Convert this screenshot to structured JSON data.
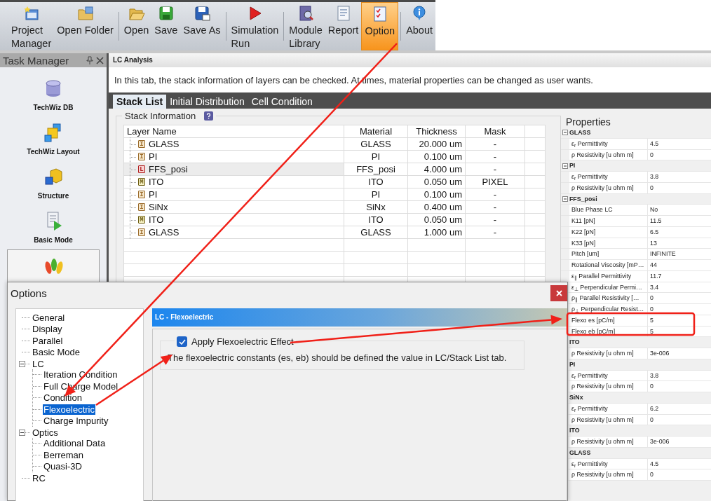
{
  "toolbar": {
    "groups": [
      [
        {
          "kind": "project",
          "lines": [
            "Project",
            "Manager"
          ],
          "selected": false
        },
        {
          "kind": "folder",
          "lines": [
            "Open Folder"
          ],
          "selected": false
        }
      ],
      [
        {
          "kind": "open",
          "lines": [
            "Open"
          ],
          "selected": false
        },
        {
          "kind": "save",
          "lines": [
            "Save"
          ],
          "selected": false
        },
        {
          "kind": "save-as",
          "lines": [
            "Save As"
          ],
          "selected": false
        }
      ],
      [
        {
          "kind": "run",
          "lines": [
            "Simulation",
            "Run"
          ],
          "selected": false
        }
      ],
      [
        {
          "kind": "library",
          "lines": [
            "Module",
            "Library"
          ],
          "selected": false
        },
        {
          "kind": "report",
          "lines": [
            "Report"
          ],
          "selected": false
        },
        {
          "kind": "option",
          "lines": [
            "Option"
          ],
          "selected": true
        }
      ],
      [
        {
          "kind": "about",
          "lines": [
            "About"
          ],
          "selected": false
        }
      ]
    ]
  },
  "task_manager": {
    "title": "Task Manager",
    "items": [
      {
        "kind": "db",
        "label": "TechWiz DB",
        "selected": false
      },
      {
        "kind": "layout",
        "label": "TechWiz Layout",
        "selected": false
      },
      {
        "kind": "structure",
        "label": "Structure",
        "selected": false
      },
      {
        "kind": "basic",
        "label": "Basic Mode",
        "selected": false
      },
      {
        "kind": "lc",
        "selected": true
      }
    ]
  },
  "analysis": {
    "title": "LC Analysis",
    "description": "In this tab, the stack information of layers can be checked. At times, material properties can be changed as user wants.",
    "tabs": [
      {
        "label": "Stack List",
        "selected": true
      },
      {
        "label": "Initial Distribution",
        "selected": false
      },
      {
        "label": "Cell Condition",
        "selected": false
      }
    ],
    "stack": {
      "title": "Stack Information",
      "columns": [
        "Layer Name",
        "Material",
        "Thickness",
        "Mask"
      ],
      "rows": [
        {
          "type": "I",
          "name": "GLASS",
          "material": "GLASS",
          "thickness": "20.000 um",
          "mask": "-",
          "selected": false
        },
        {
          "type": "I",
          "name": "PI",
          "material": "PI",
          "thickness": "0.100 um",
          "mask": "-",
          "selected": false
        },
        {
          "type": "L",
          "name": "FFS_posi",
          "material": "FFS_posi",
          "thickness": "4.000 um",
          "mask": "-",
          "selected": true
        },
        {
          "type": "M",
          "name": "ITO",
          "material": "ITO",
          "thickness": "0.050 um",
          "mask": "PIXEL",
          "selected": false
        },
        {
          "type": "I",
          "name": "PI",
          "material": "PI",
          "thickness": "0.100 um",
          "mask": "-",
          "selected": false
        },
        {
          "type": "I",
          "name": "SiNx",
          "material": "SiNx",
          "thickness": "0.400 um",
          "mask": "-",
          "selected": false
        },
        {
          "type": "M",
          "name": "ITO",
          "material": "ITO",
          "thickness": "0.050 um",
          "mask": "-",
          "selected": false
        },
        {
          "type": "I",
          "name": "GLASS",
          "material": "GLASS",
          "thickness": "1.000 um",
          "mask": "-",
          "selected": false
        }
      ]
    },
    "properties": {
      "title": "Properties",
      "groups": [
        {
          "name": "GLASS",
          "expanded": true,
          "rows": [
            {
              "label": "ε$_{r}$ Permittivity",
              "value": "4.5"
            },
            {
              "label": "ρ Resistivity [u ohm m]",
              "value": "0"
            }
          ]
        },
        {
          "name": "PI",
          "expanded": true,
          "rows": [
            {
              "label": "ε$_{r}$ Permittivity",
              "value": "3.8"
            },
            {
              "label": "ρ Resistivity [u ohm m]",
              "value": "0"
            }
          ]
        },
        {
          "name": "FFS_posi",
          "expanded": true,
          "rows": [
            {
              "label": "Blue Phase LC",
              "value": "No"
            },
            {
              "label": "K11 [pN]",
              "value": "11.5"
            },
            {
              "label": "K22 [pN]",
              "value": "6.5"
            },
            {
              "label": "K33 [pN]",
              "value": "13"
            },
            {
              "label": "Pitch [um]",
              "value": "INFINITE"
            },
            {
              "label": "Rotational Viscosity [mP…",
              "value": "44"
            },
            {
              "label": "ε$_{∥}$ Parallel Permittivity",
              "value": "11.7"
            },
            {
              "label": "ε$_{⊥}$ Perpendicular Permi…",
              "value": "3.4"
            },
            {
              "label": "ρ$_{∥}$ Parallel Resistivity […",
              "value": "0"
            },
            {
              "label": "ρ$_{⊥}$ Perpendicular Resist…",
              "value": "0"
            },
            {
              "label": "Flexo es [pC/m]",
              "value": "5"
            },
            {
              "label": "Flexo eb [pC/m]",
              "value": "5"
            }
          ]
        },
        {
          "name": "ITO",
          "expanded": true,
          "rows": [
            {
              "label": "ρ Resistivity [u ohm m]",
              "value": "3e-006"
            }
          ]
        },
        {
          "name": "PI",
          "expanded": true,
          "rows": [
            {
              "label": "ε$_{r}$ Permittivity",
              "value": "3.8"
            },
            {
              "label": "ρ Resistivity [u ohm m]",
              "value": "0"
            }
          ]
        },
        {
          "name": "SiNx",
          "expanded": true,
          "rows": [
            {
              "label": "ε$_{r}$ Permittivity",
              "value": "6.2"
            },
            {
              "label": "ρ Resistivity [u ohm m]",
              "value": "0"
            }
          ]
        },
        {
          "name": "ITO",
          "expanded": true,
          "rows": [
            {
              "label": "ρ Resistivity [u ohm m]",
              "value": "3e-006"
            }
          ]
        },
        {
          "name": "GLASS",
          "expanded": true,
          "rows": [
            {
              "label": "ε$_{r}$ Permittivity",
              "value": "4.5"
            },
            {
              "label": "ρ Resistivity [u ohm m]",
              "value": "0"
            }
          ]
        }
      ]
    }
  },
  "options_dialog": {
    "title": "Options",
    "tree": [
      {
        "label": "General",
        "selected": false
      },
      {
        "label": "Display",
        "selected": false
      },
      {
        "label": "Parallel",
        "selected": false
      },
      {
        "label": "Basic Mode",
        "selected": false
      },
      {
        "label": "LC",
        "selected": false,
        "expanded": true,
        "children": [
          {
            "label": "Iteration Condition",
            "selected": false
          },
          {
            "label": "Full Charge Model",
            "selected": false
          },
          {
            "label": "Condition",
            "selected": false
          },
          {
            "label": "Flexoelectric",
            "selected": true
          },
          {
            "label": "Charge Impurity",
            "selected": false
          }
        ]
      },
      {
        "label": "Optics",
        "selected": false,
        "expanded": true,
        "children": [
          {
            "label": "Additional Data",
            "selected": false
          },
          {
            "label": "Berreman",
            "selected": false
          },
          {
            "label": "Quasi-3D",
            "selected": false
          }
        ]
      },
      {
        "label": "RC",
        "selected": false
      }
    ],
    "page": {
      "title": "LC - Flexoelectric",
      "option": {
        "label": "Apply Flexoelectric Effect",
        "checked": true
      },
      "note": "The flexoelectric constants (es, eb) should be defined the value in LC/Stack List tab."
    }
  }
}
